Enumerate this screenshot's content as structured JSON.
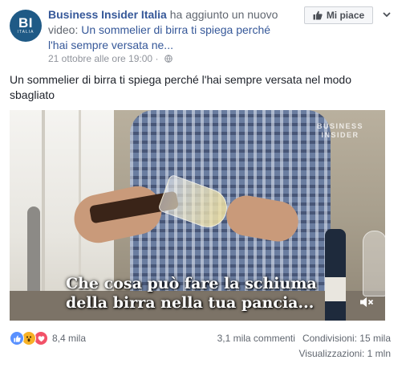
{
  "header": {
    "avatar_text": "BI",
    "avatar_subtext": "ITALIA",
    "page_name": "Business Insider Italia",
    "action_text": " ha aggiunto un nuovo video: ",
    "video_title": "Un sommelier di birra ti spiega perché l'hai sempre versata ne...",
    "timestamp": "21 ottobre alle ore 19:00",
    "separator": " · ",
    "privacy_icon": "globe-icon",
    "like_page_label": "Mi piace"
  },
  "post": {
    "text": "Un sommelier di birra ti spiega perché l'hai sempre versata nel modo sbagliato"
  },
  "video": {
    "watermark_line1": "BUSINESS",
    "watermark_line2": "INSIDER",
    "caption_line1": "Che cosa può fare la schiuma",
    "caption_line2": "della birra nella tua pancia...",
    "mute_icon": "speaker-muted-icon"
  },
  "footer": {
    "reaction_count": "8,4 mila",
    "comments": "3,1 mila commenti",
    "shares": "Condivisioni: 15 mila",
    "views": "Visualizzazioni: 1 mln"
  },
  "colors": {
    "link": "#365899",
    "avatar_bg": "#1f5a86",
    "meta_gray": "#90949c",
    "like_blue": "#5890ff",
    "love_red": "#f25268",
    "wow_yellow": "#f7b125"
  }
}
